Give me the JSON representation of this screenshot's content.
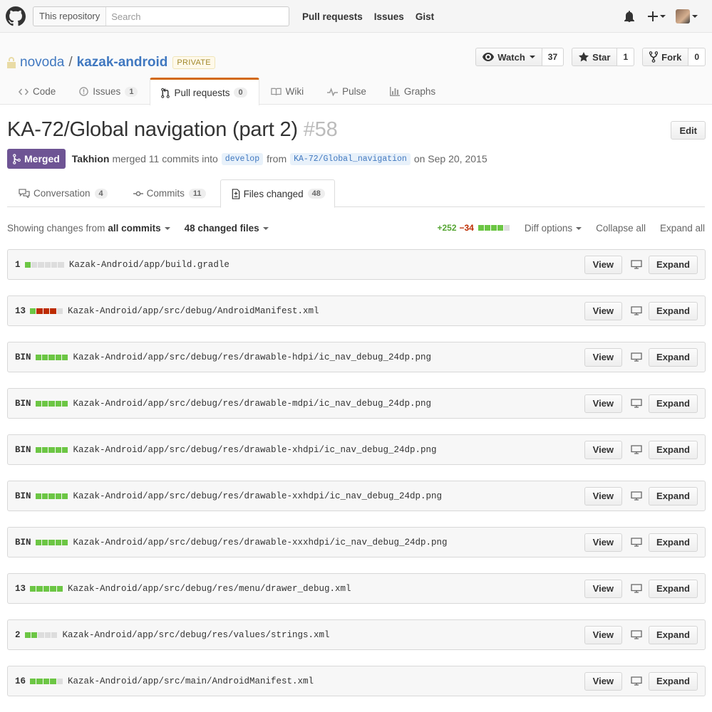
{
  "header": {
    "search_scope": "This repository",
    "search_placeholder": "Search",
    "nav": [
      "Pull requests",
      "Issues",
      "Gist"
    ]
  },
  "repo": {
    "owner": "novoda",
    "name": "kazak-android",
    "visibility": "PRIVATE",
    "watch_label": "Watch",
    "watch_count": "37",
    "star_label": "Star",
    "star_count": "1",
    "fork_label": "Fork",
    "fork_count": "0",
    "tabs": [
      {
        "label": "Code",
        "count": ""
      },
      {
        "label": "Issues",
        "count": "1"
      },
      {
        "label": "Pull requests",
        "count": "0"
      },
      {
        "label": "Wiki",
        "count": ""
      },
      {
        "label": "Pulse",
        "count": ""
      },
      {
        "label": "Graphs",
        "count": ""
      }
    ]
  },
  "pr": {
    "title": "KA-72/Global navigation (part 2)",
    "number": "#58",
    "edit_label": "Edit",
    "state": "Merged",
    "author": "Takhion",
    "action": "merged 11 commits into",
    "base": "develop",
    "from_word": "from",
    "head": "KA-72/Global_navigation",
    "date": "on Sep 20, 2015",
    "tabs": [
      {
        "label": "Conversation",
        "count": "4"
      },
      {
        "label": "Commits",
        "count": "11"
      },
      {
        "label": "Files changed",
        "count": "48"
      }
    ]
  },
  "toolbar": {
    "showing": "Showing changes from",
    "commits_scope": "all commits",
    "changed_files": "48 changed files",
    "additions": "+252",
    "deletions": "−34",
    "diff_options": "Diff options",
    "collapse_all": "Collapse all",
    "expand_all": "Expand all"
  },
  "file_buttons": {
    "view": "View",
    "expand": "Expand"
  },
  "files": [
    {
      "count": "1",
      "blocks": "addddd",
      "path": "Kazak-Android/app/build.gradle"
    },
    {
      "count": "13",
      "blocks": "arrrn",
      "path": "Kazak-Android/app/src/debug/AndroidManifest.xml"
    },
    {
      "count": "BIN",
      "blocks": "aaaaa",
      "path": "Kazak-Android/app/src/debug/res/drawable-hdpi/ic_nav_debug_24dp.png"
    },
    {
      "count": "BIN",
      "blocks": "aaaaa",
      "path": "Kazak-Android/app/src/debug/res/drawable-mdpi/ic_nav_debug_24dp.png"
    },
    {
      "count": "BIN",
      "blocks": "aaaaa",
      "path": "Kazak-Android/app/src/debug/res/drawable-xhdpi/ic_nav_debug_24dp.png"
    },
    {
      "count": "BIN",
      "blocks": "aaaaa",
      "path": "Kazak-Android/app/src/debug/res/drawable-xxhdpi/ic_nav_debug_24dp.png"
    },
    {
      "count": "BIN",
      "blocks": "aaaaa",
      "path": "Kazak-Android/app/src/debug/res/drawable-xxxhdpi/ic_nav_debug_24dp.png"
    },
    {
      "count": "13",
      "blocks": "aaaaa",
      "path": "Kazak-Android/app/src/debug/res/menu/drawer_debug.xml"
    },
    {
      "count": "2",
      "blocks": "aannn",
      "path": "Kazak-Android/app/src/debug/res/values/strings.xml"
    },
    {
      "count": "16",
      "blocks": "aaaan",
      "path": "Kazak-Android/app/src/main/AndroidManifest.xml"
    }
  ],
  "colors": {
    "merged": "#6e5494",
    "addition": "#6cc644",
    "deletion": "#bd2c00",
    "link": "#4078c0",
    "tab_accent": "#d26911"
  }
}
